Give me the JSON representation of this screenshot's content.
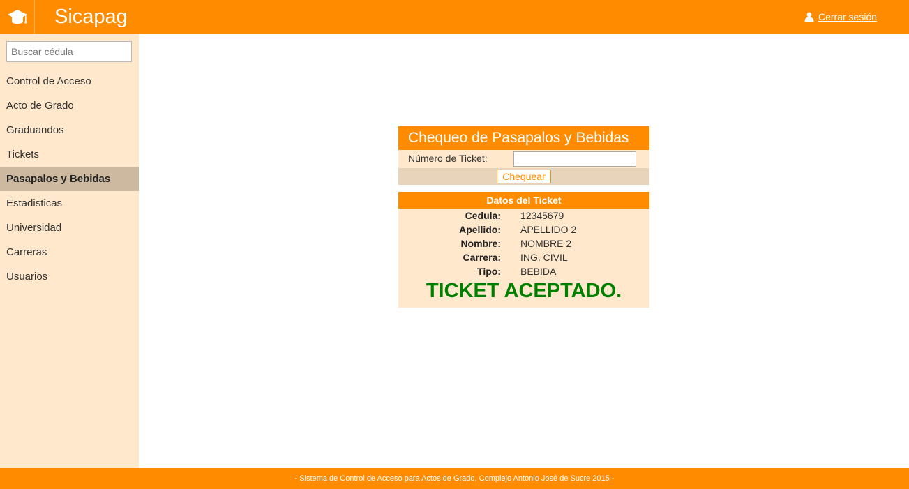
{
  "app": {
    "title": "Sicapag",
    "logo_icon": "graduation-cap-icon"
  },
  "header": {
    "logout_label": "Cerrar sesión",
    "logout_icon": "user-icon"
  },
  "sidebar": {
    "search_placeholder": "Buscar cédula",
    "items": [
      {
        "label": "Control de Acceso",
        "active": false
      },
      {
        "label": "Acto de Grado",
        "active": false
      },
      {
        "label": "Graduandos",
        "active": false
      },
      {
        "label": "Tickets",
        "active": false
      },
      {
        "label": "Pasapalos y Bebidas",
        "active": true
      },
      {
        "label": "Estadisticas",
        "active": false
      },
      {
        "label": "Universidad",
        "active": false
      },
      {
        "label": "Carreras",
        "active": false
      },
      {
        "label": "Usuarios",
        "active": false
      }
    ]
  },
  "check": {
    "title": "Chequeo de Pasapalos y Bebidas",
    "ticket_label": "Número de Ticket:",
    "ticket_value": "",
    "button_label": "Chequear"
  },
  "ticket_data": {
    "title": "Datos del Ticket",
    "rows": [
      {
        "label": "Cedula:",
        "value": "12345679"
      },
      {
        "label": "Apellido:",
        "value": "APELLIDO 2"
      },
      {
        "label": "Nombre:",
        "value": "NOMBRE 2"
      },
      {
        "label": "Carrera:",
        "value": "ING. CIVIL"
      },
      {
        "label": "Tipo:",
        "value": "BEBIDA"
      }
    ],
    "status": "TICKET ACEPTADO."
  },
  "footer": {
    "text": "-  Sistema de Control de Acceso para Actos de Grado, Complejo Antonio José de Sucre 2015  -"
  },
  "colors": {
    "brand": "#ff8c00",
    "sidebar_bg": "#ffe8cc",
    "active_item": "#cdb9a0",
    "success": "#008000"
  }
}
